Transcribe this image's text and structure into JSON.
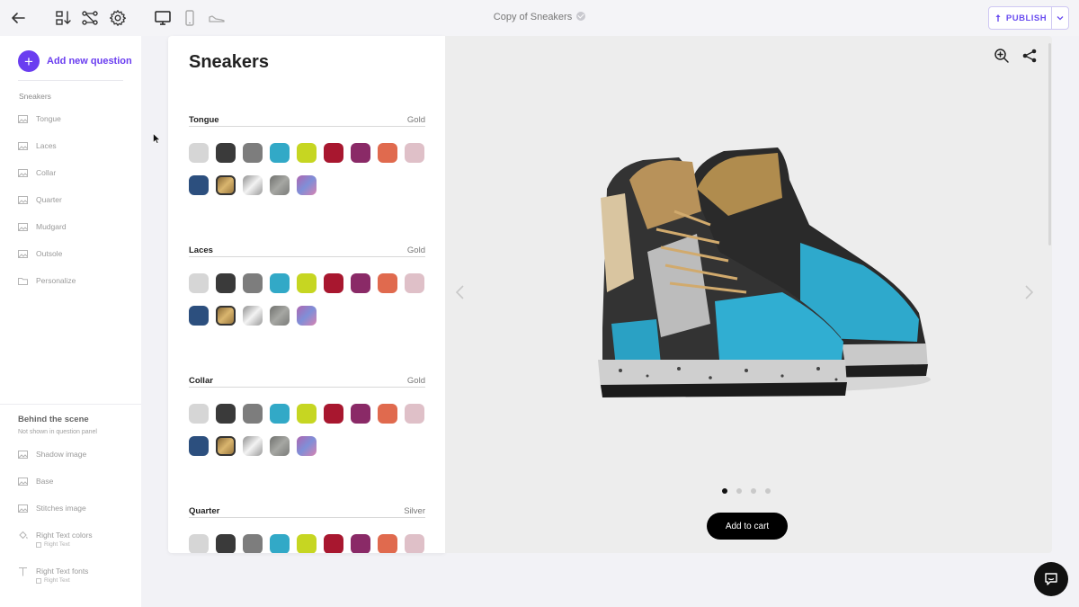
{
  "header": {
    "doc_title": "Copy of Sneakers",
    "publish_label": "PUBLISH",
    "icons": [
      "back-arrow-icon",
      "sort-icon",
      "flow-icon",
      "gear-icon",
      "desktop-icon",
      "mobile-icon",
      "sneaker-icon",
      "check-badge-icon",
      "publish-icon",
      "chevron-down-icon"
    ]
  },
  "sidebar": {
    "add_question_label": "Add new question",
    "section_title": "Sneakers",
    "items": [
      {
        "label": "Tongue",
        "icon": "image-icon"
      },
      {
        "label": "Laces",
        "icon": "image-icon"
      },
      {
        "label": "Collar",
        "icon": "image-icon"
      },
      {
        "label": "Quarter",
        "icon": "image-icon"
      },
      {
        "label": "Mudgard",
        "icon": "image-icon"
      },
      {
        "label": "Outsole",
        "icon": "image-icon"
      },
      {
        "label": "Personalize",
        "icon": "folder-icon"
      }
    ],
    "behind_title": "Behind the scene",
    "behind_subtitle": "Not shown in question panel",
    "behind_items": [
      {
        "label": "Shadow image",
        "icon": "image-icon"
      },
      {
        "label": "Base",
        "icon": "image-icon"
      },
      {
        "label": "Stitches image",
        "icon": "image-icon"
      },
      {
        "label": "Right Text colors",
        "sub": "Right Text",
        "icon": "paint-bucket-icon"
      },
      {
        "label": "Right Text fonts",
        "sub": "Right Text",
        "icon": "text-icon"
      }
    ]
  },
  "panel": {
    "title": "Sneakers",
    "questions": [
      {
        "name": "Tongue",
        "value": "Gold"
      },
      {
        "name": "Laces",
        "value": "Gold"
      },
      {
        "name": "Collar",
        "value": "Gold"
      },
      {
        "name": "Quarter",
        "value": "Silver"
      }
    ],
    "swatch_colors": [
      "#d6d6d6",
      "#3a3a3a",
      "#7d7d7d",
      "#32a9c7",
      "#c6d622",
      "#a8172f",
      "#8a2a67",
      "#e06a4e",
      "#dfc0c8",
      "#2c4f7e",
      "gold",
      "silver",
      "stone",
      "holo"
    ],
    "selected_swatch_name": "gold"
  },
  "viewer": {
    "add_to_cart_label": "Add to cart",
    "carousel_active_index": 0,
    "carousel_count": 4,
    "icons": [
      "zoom-in-icon",
      "share-icon",
      "chevron-left-icon",
      "chevron-right-icon"
    ]
  },
  "chat": {
    "icon": "chat-icon"
  }
}
